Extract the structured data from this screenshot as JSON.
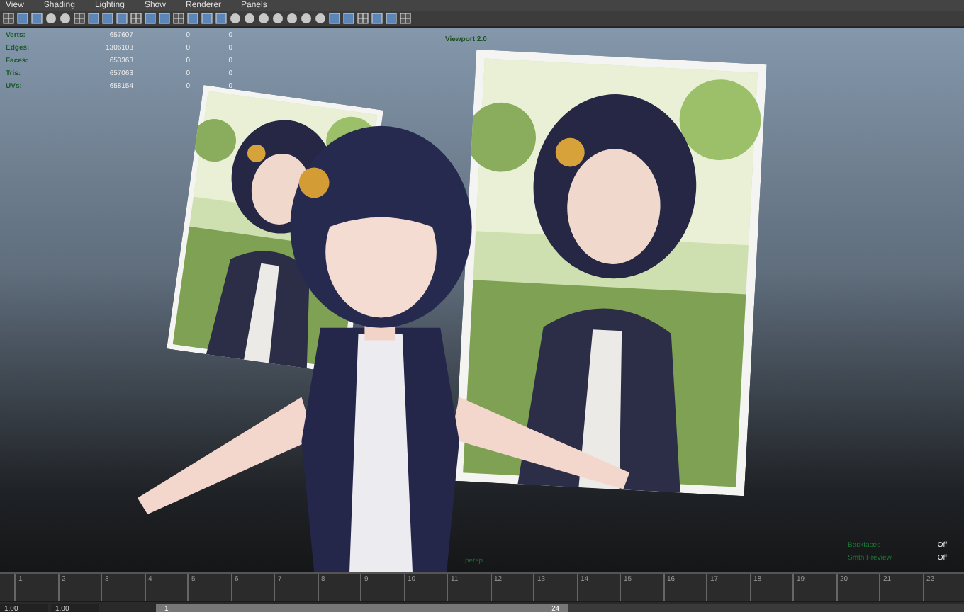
{
  "menu_bar": [
    "View",
    "Shading",
    "Lighting",
    "Show",
    "Renderer",
    "Panels"
  ],
  "viewport": {
    "title": "Viewport 2.0",
    "camera": "persp",
    "hud": [
      {
        "label": "Verts:",
        "values": [
          "657607",
          "0",
          "0"
        ]
      },
      {
        "label": "Edges:",
        "values": [
          "1306103",
          "0",
          "0"
        ]
      },
      {
        "label": "Faces:",
        "values": [
          "653363",
          "0",
          "0"
        ]
      },
      {
        "label": "Tris:",
        "values": [
          "657063",
          "0",
          "0"
        ]
      },
      {
        "label": "UVs:",
        "values": [
          "658154",
          "0",
          "0"
        ]
      }
    ],
    "hud_settings": [
      {
        "label": "Backfaces",
        "value": "Off"
      },
      {
        "label": "Smth Preview",
        "value": "Off"
      }
    ],
    "objects": [
      {
        "kind": "picture"
      },
      {
        "kind": "picture"
      },
      {
        "kind": "model"
      }
    ]
  },
  "timeline": {
    "ticks": [
      "1",
      "2",
      "3",
      "4",
      "5",
      "6",
      "7",
      "8",
      "9",
      "10",
      "11",
      "12",
      "13",
      "14",
      "15",
      "16",
      "17",
      "18",
      "19",
      "20",
      "21",
      "22"
    ]
  },
  "range": {
    "start": "1.00",
    "playback_start": "1.00",
    "slider_start": "1",
    "slider_end": "24",
    "level": 0.51
  }
}
